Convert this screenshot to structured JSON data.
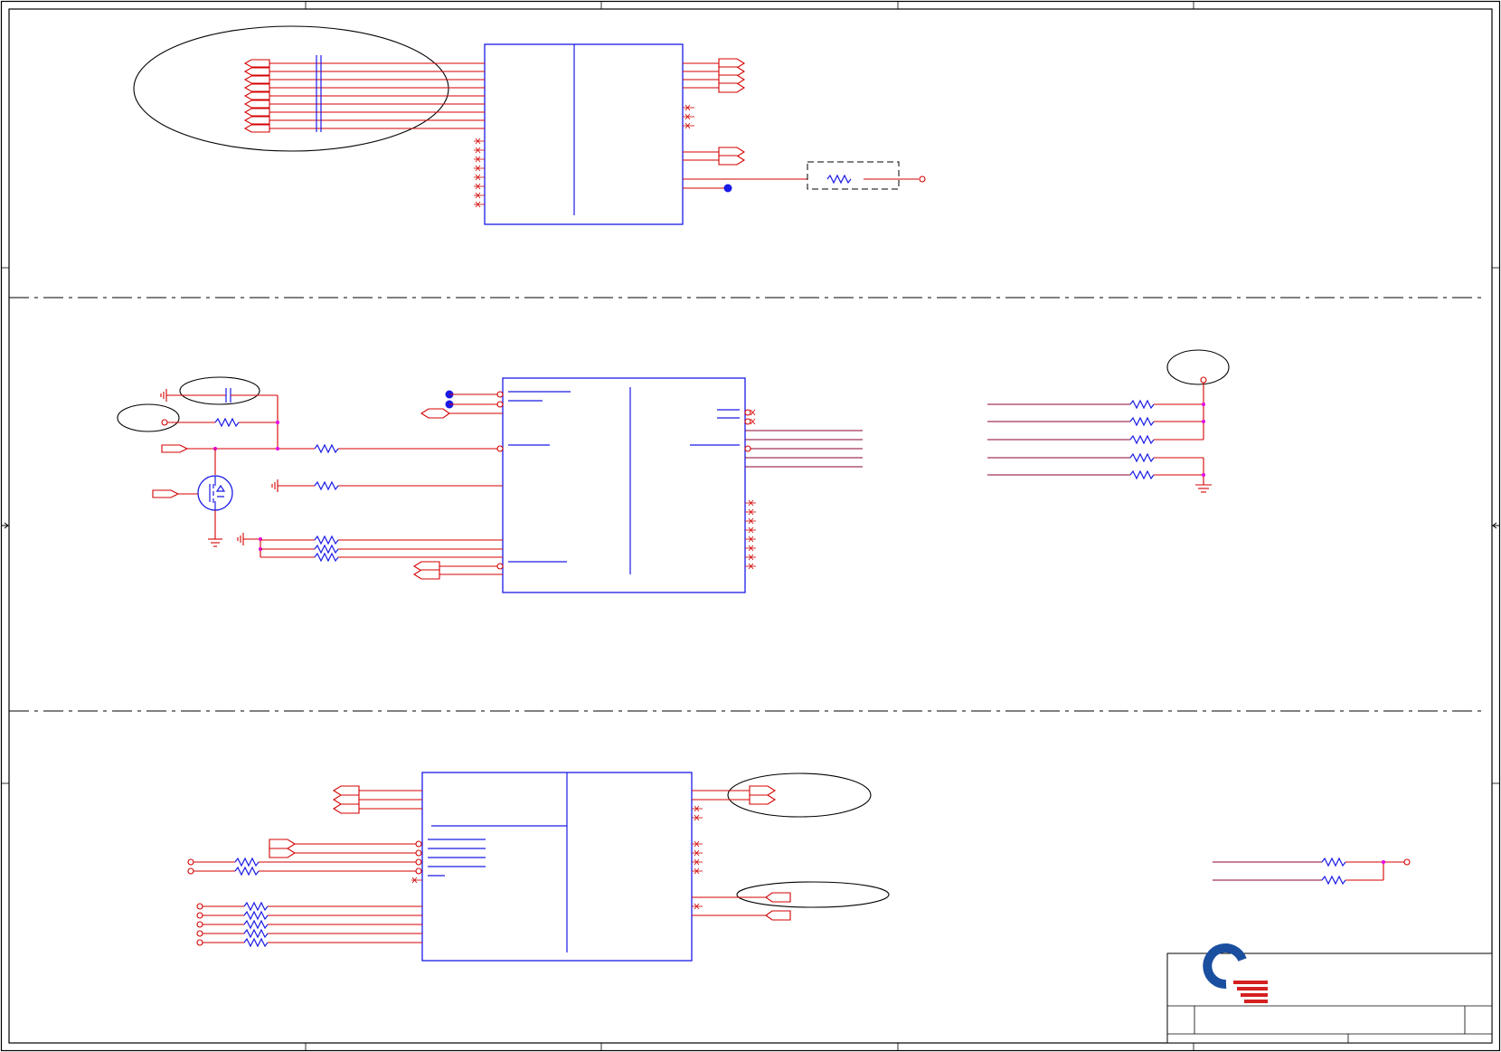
{
  "sheet": {
    "title": "",
    "border_marks": true
  },
  "logo": {
    "name": "quanta-logo",
    "colors": {
      "ring": "#1a4fa0",
      "stripes": "#d42020"
    }
  },
  "colors": {
    "wire": "#d40000",
    "component": "#1a1ae6",
    "junction": "#e600e6",
    "frame": "#000000"
  },
  "sections": [
    {
      "name": "top-section",
      "components": [
        "ic-u1",
        "capacitor-bank",
        "resistor-r-top"
      ]
    },
    {
      "name": "middle-section",
      "components": [
        "ic-u2",
        "mosfet-q1",
        "resistor-network-right"
      ]
    },
    {
      "name": "bottom-section",
      "components": [
        "ic-u3",
        "resistor-pair-right"
      ]
    }
  ]
}
